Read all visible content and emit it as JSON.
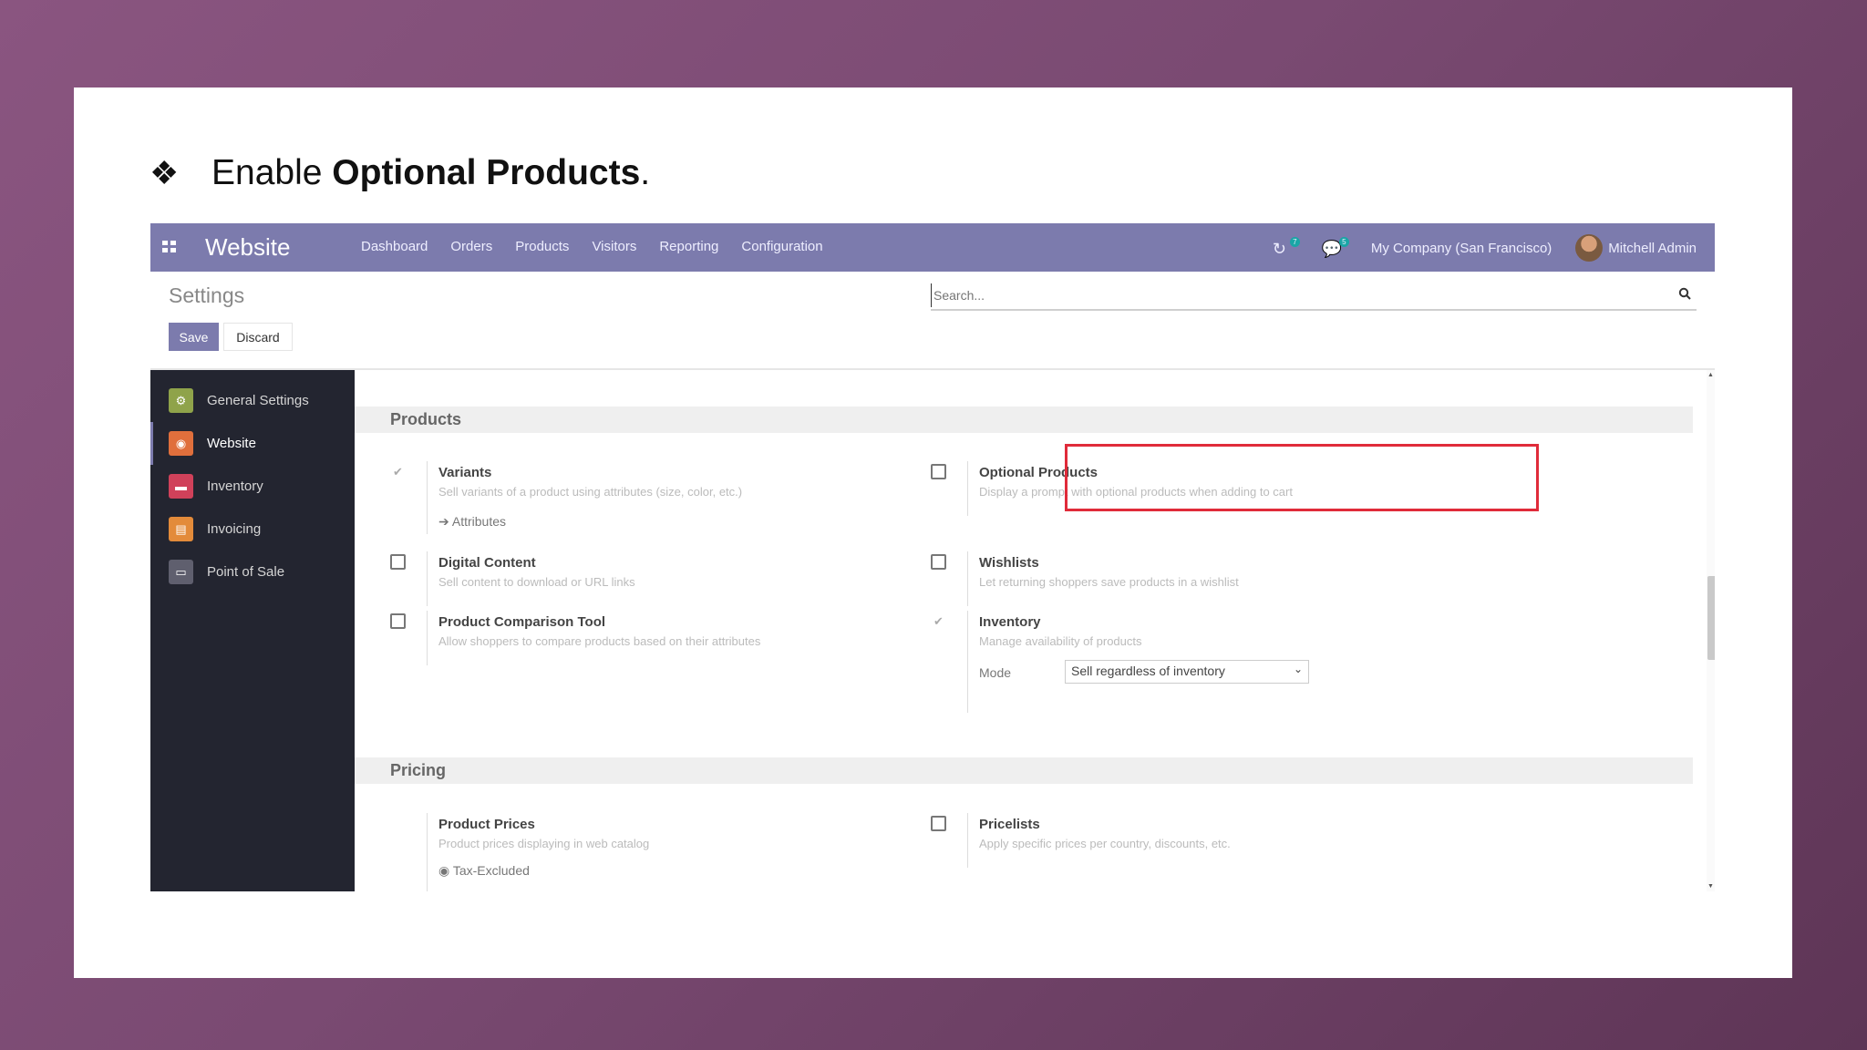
{
  "headline": {
    "bullet": "❖",
    "prefix": "Enable ",
    "bold": "Optional Products",
    "suffix": "."
  },
  "navbar": {
    "app_name": "Website",
    "menu": [
      "Dashboard",
      "Orders",
      "Products",
      "Visitors",
      "Reporting",
      "Configuration"
    ],
    "activity_badge": "7",
    "messages_badge": "5",
    "company": "My Company (San Francisco)",
    "user": "Mitchell Admin"
  },
  "control_panel": {
    "title": "Settings",
    "save_label": "Save",
    "discard_label": "Discard",
    "search_placeholder": "Search..."
  },
  "sidebar": {
    "items": [
      {
        "label": "General Settings",
        "color": "#8fa34a",
        "icon": "gear-icon"
      },
      {
        "label": "Website",
        "color": "#e06f3c",
        "icon": "globe-icon"
      },
      {
        "label": "Inventory",
        "color": "#d0415a",
        "icon": "box-icon"
      },
      {
        "label": "Invoicing",
        "color": "#e38b3a",
        "icon": "invoice-icon"
      },
      {
        "label": "Point of Sale",
        "color": "#5f5f6e",
        "icon": "store-icon"
      }
    ]
  },
  "sections": {
    "products": {
      "title": "Products",
      "variants": {
        "title": "Variants",
        "desc": "Sell variants of a product using attributes (size, color, etc.)",
        "link": "Attributes"
      },
      "optional": {
        "title": "Optional Products",
        "desc": "Display a prompt with optional products when adding to cart"
      },
      "digital": {
        "title": "Digital Content",
        "desc": "Sell content to download or URL links"
      },
      "wishlists": {
        "title": "Wishlists",
        "desc": "Let returning shoppers save products in a wishlist"
      },
      "comparison": {
        "title": "Product Comparison Tool",
        "desc": "Allow shoppers to compare products based on their attributes"
      },
      "inventory": {
        "title": "Inventory",
        "desc": "Manage availability of products",
        "mode_label": "Mode",
        "mode_value": "Sell regardless of inventory"
      }
    },
    "pricing": {
      "title": "Pricing",
      "prices": {
        "title": "Product Prices",
        "desc": "Product prices displaying in web catalog",
        "option": "Tax-Excluded"
      },
      "pricelists": {
        "title": "Pricelists",
        "desc": "Apply specific prices per country, discounts, etc."
      }
    }
  },
  "colors": {
    "navbar": "#7c7bad",
    "sidebar": "#232530",
    "highlight": "#e02b3a"
  }
}
